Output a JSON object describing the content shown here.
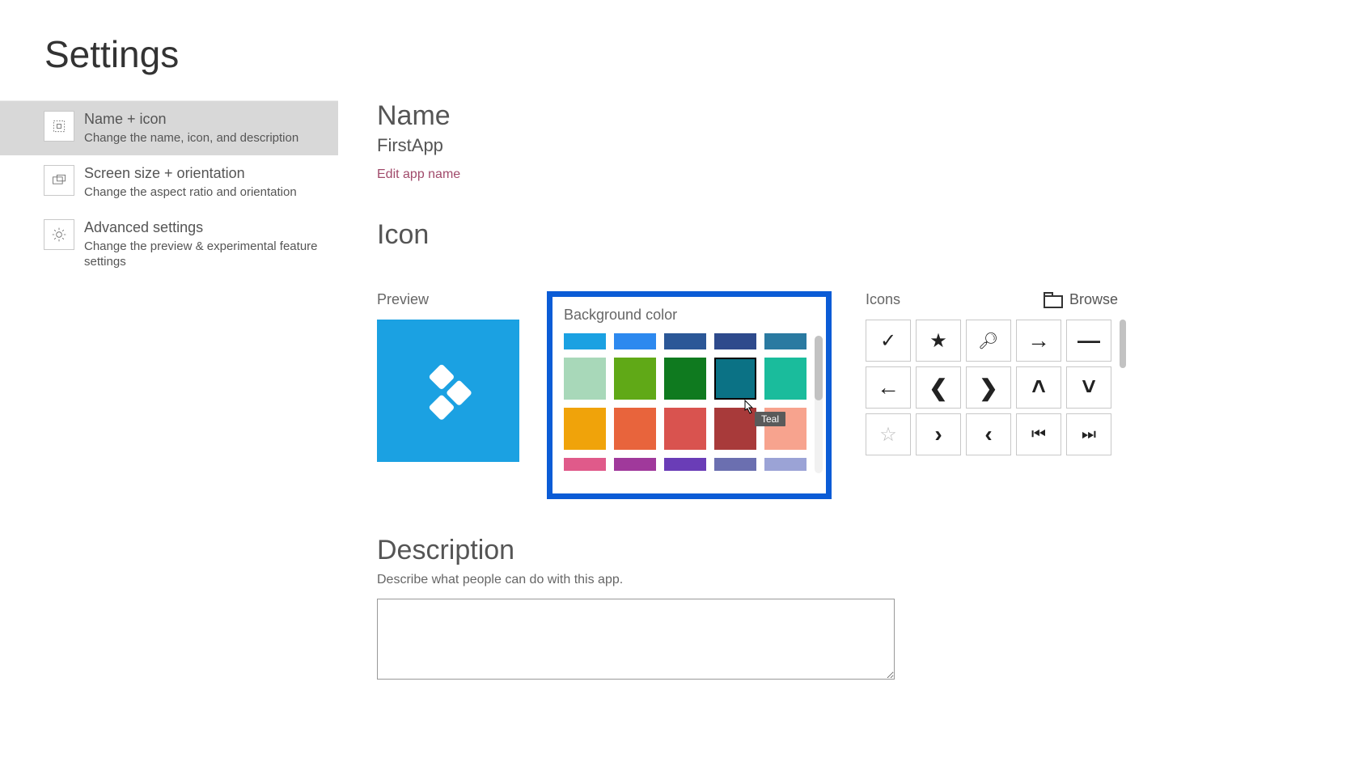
{
  "page_title": "Settings",
  "sidebar": {
    "items": [
      {
        "title": "Name + icon",
        "desc": "Change the name, icon, and description",
        "icon": "name-icon",
        "selected": true
      },
      {
        "title": "Screen size + orientation",
        "desc": "Change the aspect ratio and orientation",
        "icon": "screen-icon",
        "selected": false
      },
      {
        "title": "Advanced settings",
        "desc": "Change the preview & experimental feature settings",
        "icon": "gear-icon",
        "selected": false
      }
    ]
  },
  "name_section": {
    "heading": "Name",
    "value": "FirstApp",
    "edit_link": "Edit app name"
  },
  "icon_section": {
    "heading": "Icon",
    "preview_label": "Preview",
    "preview_bg": "#1ba1e2",
    "bgcolor_label": "Background color",
    "swatches": [
      [
        "#1ba1e2",
        "#2d89ef",
        "#2b5797",
        "#2e4a8c",
        "#2a7aa1"
      ],
      [
        "#a8d8b9",
        "#60a917",
        "#0f7a1f",
        "#0b7285",
        "#1abc9c"
      ],
      [
        "#f0a30a",
        "#e8643c",
        "#d9534f",
        "#a83a3a",
        "#f7a38e"
      ],
      [
        "#e05a8a",
        "#a0399b",
        "#6a3db7",
        "#6b6fb0",
        "#9ba3d6"
      ]
    ],
    "selected_swatch": {
      "row": 1,
      "col": 3
    },
    "tooltip_text": "Teal",
    "icons_label": "Icons",
    "browse_label": "Browse",
    "icon_choices": [
      "check",
      "star-filled",
      "search",
      "arrow-right",
      "minus",
      "arrow-left",
      "chevron-left-bold",
      "chevron-right-bold",
      "chevron-up-bold",
      "chevron-down-bold",
      "star-outline",
      "angle-right",
      "angle-left",
      "skip-prev",
      "skip-next"
    ]
  },
  "description_section": {
    "heading": "Description",
    "hint": "Describe what people can do with this app.",
    "value": ""
  }
}
